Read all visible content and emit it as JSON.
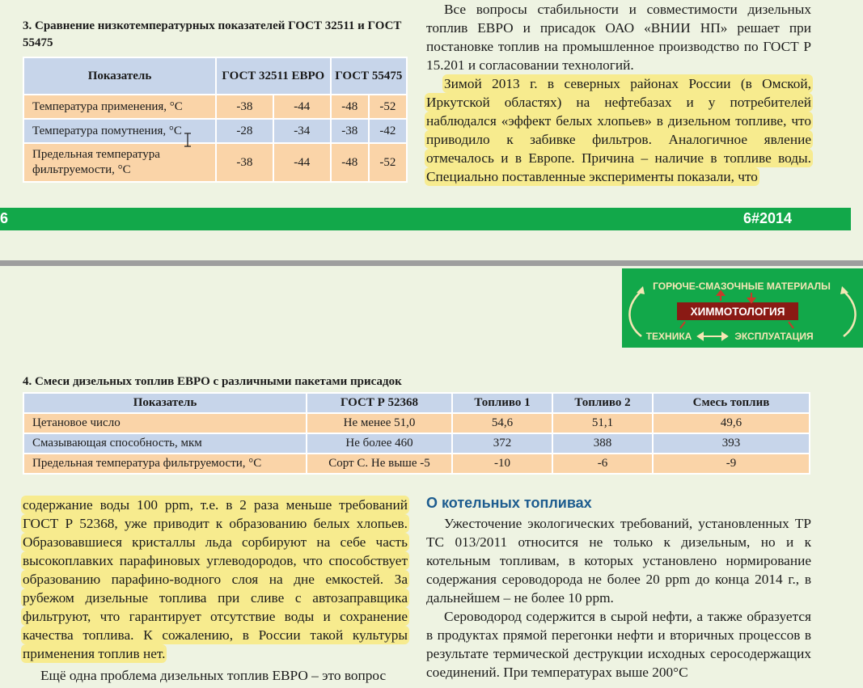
{
  "page1": {
    "table3": {
      "caption": "3. Сравнение низкотемпературных показателей ГОСТ 32511 и ГОСТ 55475",
      "head": {
        "indicator": "Показатель",
        "g1": "ГОСТ 32511 ЕВРО",
        "g2": "ГОСТ 55475"
      },
      "rows": [
        {
          "label": "Температура применения, °С",
          "v": [
            "-38",
            "-44",
            "-48",
            "-52"
          ]
        },
        {
          "label": "Температура помутнения, °С",
          "v": [
            "-28",
            "-34",
            "-38",
            "-42"
          ]
        },
        {
          "label": "Предельная температура фильтруемости, °С",
          "v": [
            "-38",
            "-44",
            "-48",
            "-52"
          ]
        }
      ]
    },
    "right": {
      "p1": "Все вопросы стабильности и совместимости дизельных топлив ЕВРО и присадок ОАО «ВНИИ НП» решает при постановке топлив на промышленное производство по ГОСТ Р 15.201 и согласовании технологий.",
      "p2": "Зимой 2013 г. в северных районах России (в Омской, Иркутской областях) на нефтебазах и у потребителей наблюдался «эффект белых хлопьев» в дизельном топливе, что приводило к забивке фильтров. Аналогичное явление отмечалось и в Европе. Причина – наличие в топливе воды. Специально поставленные эксперименты показали, что"
    },
    "footer": {
      "page_num": "6",
      "issue": "6#2014"
    }
  },
  "logo": {
    "top": "ГОРЮЧЕ-СМАЗОЧНЫЕ МАТЕРИАЛЫ",
    "center": "ХИММОТОЛОГИЯ",
    "left": "ТЕХНИКА",
    "right": "ЭКСПЛУАТАЦИЯ"
  },
  "page2": {
    "table4": {
      "caption": "4. Смеси дизельных топлив ЕВРО с различными пакетами присадок",
      "head": [
        "Показатель",
        "ГОСТ Р 52368",
        "Топливо 1",
        "Топливо 2",
        "Смесь топлив"
      ],
      "rows": [
        [
          "Цетановое число",
          "Не менее 51,0",
          "54,6",
          "51,1",
          "49,6"
        ],
        [
          "Смазывающая способность, мкм",
          "Не более 460",
          "372",
          "388",
          "393"
        ],
        [
          "Предельная температура фильтруемости, °С",
          "Сорт С. Не выше -5",
          "-10",
          "-6",
          "-9"
        ]
      ]
    },
    "left": {
      "p1": "содержание воды 100 ppm, т.е. в 2 раза меньше требований ГОСТ Р 52368, уже приводит к образованию белых хлопьев. Образовавшиеся кристаллы льда сорбируют на себе часть высокоплавких парафиновых углеводородов, что способствует образованию парафино-водного слоя на дне емкостей. За рубежом дизельные топлива при сливе с автозаправщика фильтруют, что гарантирует отсутствие воды и сохранение качества топлива. К сожалению, в России такой культуры применения топлив нет.",
      "p2": "Ещё одна проблема дизельных топлив ЕВРО – это вопрос"
    },
    "right": {
      "heading": "О котельных топливах",
      "p1": "Ужесточение экологических требований, установленных ТР ТС 013/2011 относится не только к дизельным, но и к котельным топливам, в которых установлено нормирование содержания сероводорода не более 20 ppm до конца 2014 г., в дальнейшем – не более 10 ppm.",
      "p2": "Сероводород содержится в сырой нефти, а также образуется в продуктах прямой перегонки нефти и вторичных процессов в результате термической деструкции исходных серосодержащих соединений. При температурах выше 200°С"
    }
  }
}
